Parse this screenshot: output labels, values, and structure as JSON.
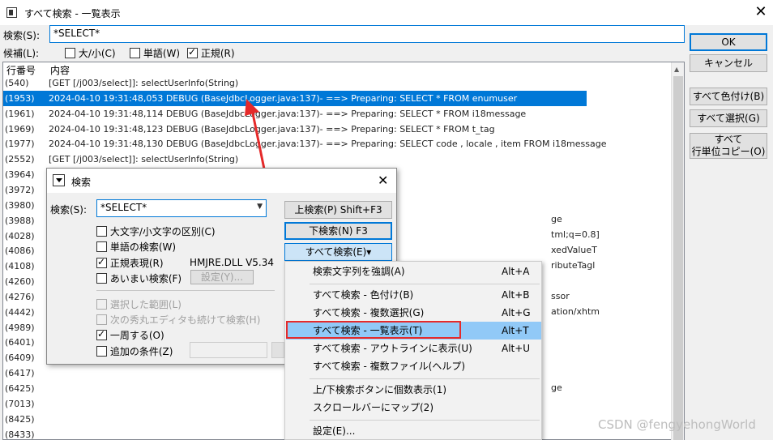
{
  "window": {
    "title": "すべて検索 - 一覧表示",
    "close_glyph": "✕"
  },
  "search": {
    "label": "検索(S):",
    "value": "*SELECT*"
  },
  "options": {
    "label": "候補(L):",
    "case": "大/小(C)",
    "word": "単語(W)",
    "regex": "正規(R)"
  },
  "buttons": {
    "ok": "OK",
    "cancel": "キャンセル",
    "color_all": "すべて色付け(B)",
    "select_all": "すべて選択(G)",
    "copy_line": "すべて\n行単位コピー(O)"
  },
  "list": {
    "header_line": "行番号",
    "header_content": "内容",
    "rows": [
      {
        "num": "(540)",
        "text": "  [GET [/j003/select]]: selectUserInfo(String)"
      },
      {
        "num": "(1953)",
        "text": "2024-04-10 19:31:48,053 DEBUG (BaseJdbcLogger.java:137)- ==>  Preparing: SELECT * FROM enumuser"
      },
      {
        "num": "(1961)",
        "text": "2024-04-10 19:31:48,114 DEBUG (BaseJdbcLogger.java:137)- ==>  Preparing: SELECT * FROM i18message"
      },
      {
        "num": "(1969)",
        "text": "2024-04-10 19:31:48,123 DEBUG (BaseJdbcLogger.java:137)- ==>  Preparing: SELECT * FROM t_tag"
      },
      {
        "num": "(1977)",
        "text": "2024-04-10 19:31:48,130 DEBUG (BaseJdbcLogger.java:137)- ==>  Preparing: SELECT code , locale , item FROM i18message"
      },
      {
        "num": "(2552)",
        "text": "  [GET [/j003/select]]: selectUserInfo(String)"
      },
      {
        "num": "(3964)",
        "text": ""
      },
      {
        "num": "(3972)",
        "text": ""
      },
      {
        "num": "(3980)",
        "text": ""
      },
      {
        "num": "(3988)",
        "text": ""
      },
      {
        "num": "(4028)",
        "text": ""
      },
      {
        "num": "(4086)",
        "text": ""
      },
      {
        "num": "(4108)",
        "text": ""
      },
      {
        "num": "(4260)",
        "text": ""
      },
      {
        "num": "(4276)",
        "text": ""
      },
      {
        "num": "(4442)",
        "text": ""
      },
      {
        "num": "(4989)",
        "text": ""
      },
      {
        "num": "(6401)",
        "text": ""
      },
      {
        "num": "(6409)",
        "text": ""
      },
      {
        "num": "(6417)",
        "text": ""
      },
      {
        "num": "(6425)",
        "text": ""
      },
      {
        "num": "(7013)",
        "text": ""
      },
      {
        "num": "(8425)",
        "text": ""
      },
      {
        "num": "(8433)",
        "text": ""
      }
    ],
    "fragments": [
      "ge",
      "tml;q=0.8]",
      "xedValueT",
      "ributeTagl",
      "ssor",
      "ation/xhtm",
      "ge"
    ]
  },
  "dialog": {
    "title": "検索",
    "close_glyph": "✕",
    "search_label": "検索(S):",
    "search_value": "*SELECT*",
    "btn_up": "上検索(P) Shift+F3",
    "btn_down": "下検索(N) F3",
    "btn_all": "すべて検索(E)▾",
    "opt_case": "大文字/小文字の区別(C)",
    "opt_word": "単語の検索(W)",
    "opt_regex": "正規表現(R)",
    "regex_lib": "HMJRE.DLL V5.34",
    "opt_fuzzy": "あいまい検索(F)",
    "btn_settings": "設定(Y)...",
    "opt_range": "選択した範囲(L)",
    "opt_next_editor": "次の秀丸エディタも続けて検索(H)",
    "opt_wrap": "一周する(O)",
    "opt_extra": "追加の条件(Z)"
  },
  "menu": {
    "items": [
      {
        "label": "検索文字列を強調(A)",
        "shortcut": "Alt+A"
      },
      {
        "label": "すべて検索 - 色付け(B)",
        "shortcut": "Alt+B"
      },
      {
        "label": "すべて検索 - 複数選択(G)",
        "shortcut": "Alt+G"
      },
      {
        "label": "すべて検索 - 一覧表示(T)",
        "shortcut": "Alt+T"
      },
      {
        "label": "すべて検索 - アウトラインに表示(U)",
        "shortcut": "Alt+U"
      },
      {
        "label": "すべて検索 - 複数ファイル(ヘルプ)",
        "shortcut": ""
      },
      {
        "label": "上/下検索ボタンに個数表示(1)",
        "shortcut": ""
      },
      {
        "label": "スクロールバーにマップ(2)",
        "shortcut": ""
      },
      {
        "label": "設定(E)...",
        "shortcut": ""
      }
    ]
  },
  "watermark": "CSDN @fengyehongWorld",
  "accent": "#0078d7",
  "highlight_color": "#e52a2a"
}
